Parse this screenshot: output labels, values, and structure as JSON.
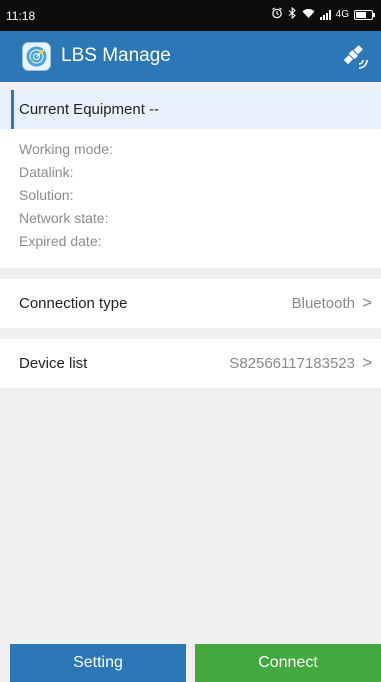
{
  "status_bar": {
    "time": "11:18",
    "network_label": "4G"
  },
  "app_bar": {
    "title": "LBS Manage",
    "logo_icon": "radar-logo-icon",
    "action_icon": "satellite-icon",
    "color": "#2c77b6"
  },
  "current_equipment": {
    "heading": "Current Equipment --",
    "fields": [
      "Working mode:",
      "Datalink:",
      "Solution:",
      "Network state:",
      "Expired date:"
    ]
  },
  "connection_type": {
    "label": "Connection type",
    "value": "Bluetooth",
    "chevron": ">"
  },
  "device_list": {
    "label": "Device list",
    "value": "S82566117183523",
    "chevron": ">"
  },
  "buttons": {
    "setting": "Setting",
    "connect": "Connect",
    "setting_color": "#2c77b6",
    "connect_color": "#43a93f"
  }
}
